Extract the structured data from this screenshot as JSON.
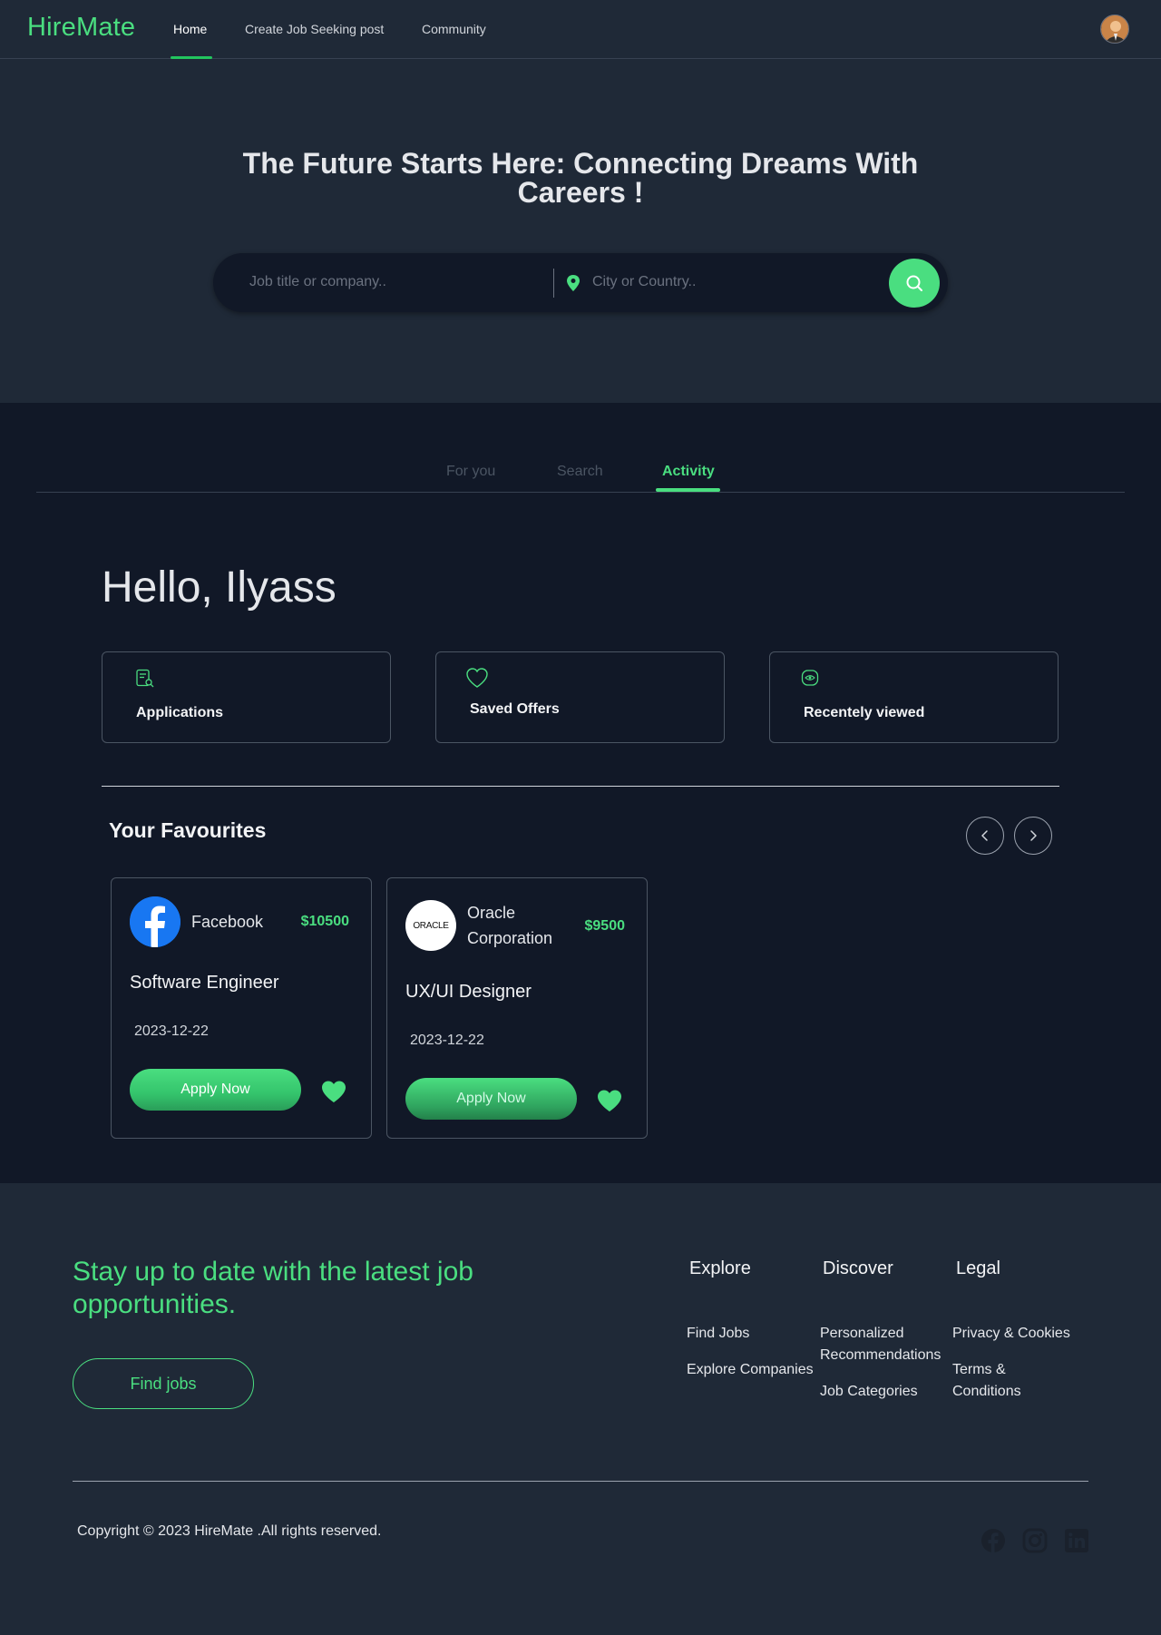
{
  "nav": {
    "logo": "HireMate",
    "links": [
      {
        "label": "Home",
        "active": true
      },
      {
        "label": "Create Job Seeking post",
        "active": false
      },
      {
        "label": "Community",
        "active": false
      }
    ],
    "avatar_icon": "user-avatar"
  },
  "hero": {
    "title": "The Future Starts Here: Connecting Dreams With Careers !",
    "search": {
      "job_placeholder": "Job title or company..",
      "job_value": "",
      "location_placeholder": "City or Country..",
      "location_value": "",
      "location_icon": "map-pin-icon",
      "button_icon": "search-icon"
    }
  },
  "tabs": [
    {
      "label": "For you",
      "active": false
    },
    {
      "label": "Search",
      "active": false
    },
    {
      "label": "Activity",
      "active": true
    }
  ],
  "greeting": "Hello, Ilyass",
  "stats": [
    {
      "label": "Applications",
      "icon": "document-search-icon"
    },
    {
      "label": "Saved Offers",
      "icon": "heart-icon"
    },
    {
      "label": "Recentely viewed",
      "icon": "eye-icon"
    }
  ],
  "favourites": {
    "title": "Your Favourites",
    "jobs": [
      {
        "company": "Facebook",
        "salary": "$10500",
        "title": "Software Engineer",
        "date": "2023-12-22",
        "apply_label": "Apply Now",
        "logo": "facebook-logo"
      },
      {
        "company": "Oracle Corporation",
        "salary": "$9500",
        "title": "UX/UI Designer",
        "date": "2023-12-22",
        "apply_label": "Apply Now",
        "logo": "oracle-logo",
        "logo_text": "ORACLE"
      }
    ]
  },
  "footer": {
    "tagline": "Stay up to date with the latest job opportunities.",
    "cta": "Find jobs",
    "columns": [
      {
        "heading": "Explore",
        "links": [
          "Find Jobs",
          "Explore Companies"
        ]
      },
      {
        "heading": "Discover",
        "links": [
          "Personalized Recommendations",
          "Job Categories"
        ]
      },
      {
        "heading": "Legal",
        "links": [
          "Privacy & Cookies",
          "Terms & Conditions"
        ]
      }
    ],
    "copyright": "Copyright © 2023 HireMate .All rights reserved.",
    "social": [
      "facebook-icon",
      "instagram-icon",
      "linkedin-icon"
    ]
  },
  "colors": {
    "accent": "#4ade80",
    "page_bg": "#1f2937",
    "section_bg": "#111827"
  }
}
